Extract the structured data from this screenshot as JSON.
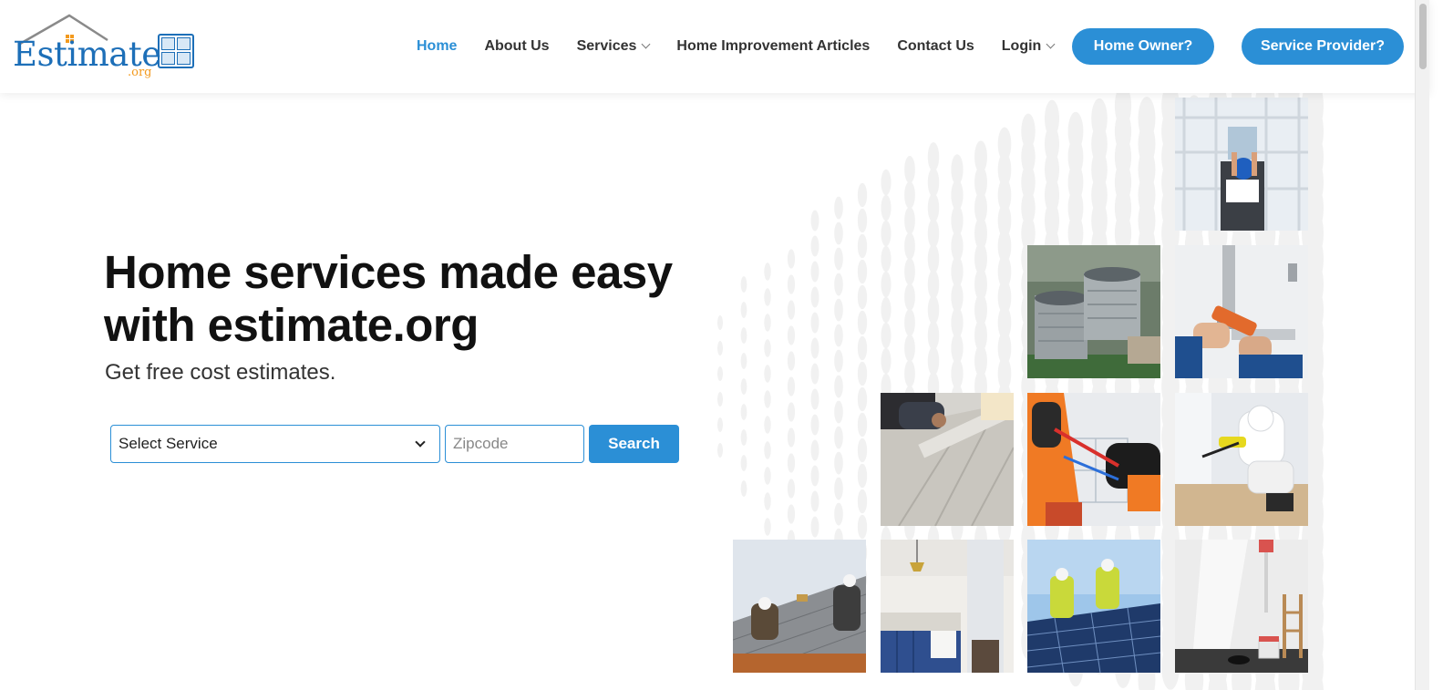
{
  "logo": {
    "word": "Estimate",
    "suffix": ".org"
  },
  "nav": {
    "items": [
      {
        "label": "Home",
        "active": true
      },
      {
        "label": "About Us"
      },
      {
        "label": "Services",
        "has_dropdown": true
      },
      {
        "label": "Home Improvement Articles"
      },
      {
        "label": "Contact Us"
      },
      {
        "label": "Login",
        "has_dropdown": true
      }
    ],
    "home_owner": "Home Owner?",
    "service_provider": "Service Provider?"
  },
  "hero": {
    "title_line1": "Home services made easy",
    "title_line2": "with estimate.org",
    "subtitle": "Get free cost estimates.",
    "select_value": "Select Service",
    "zip_placeholder": "Zipcode",
    "search_label": "Search"
  },
  "tiles": [
    {
      "name": "window-installer-photo"
    },
    {
      "name": "ac-units-photo"
    },
    {
      "name": "plumber-pipe-photo"
    },
    {
      "name": "flooring-install-photo"
    },
    {
      "name": "electrician-wiring-photo"
    },
    {
      "name": "pest-control-photo"
    },
    {
      "name": "roofers-photo"
    },
    {
      "name": "kitchen-photo"
    },
    {
      "name": "solar-panels-photo"
    },
    {
      "name": "painting-room-photo"
    }
  ],
  "colors": {
    "accent": "#2b8fd6",
    "brand": "#1d6fb8",
    "brand_orange": "#f39a1e"
  }
}
